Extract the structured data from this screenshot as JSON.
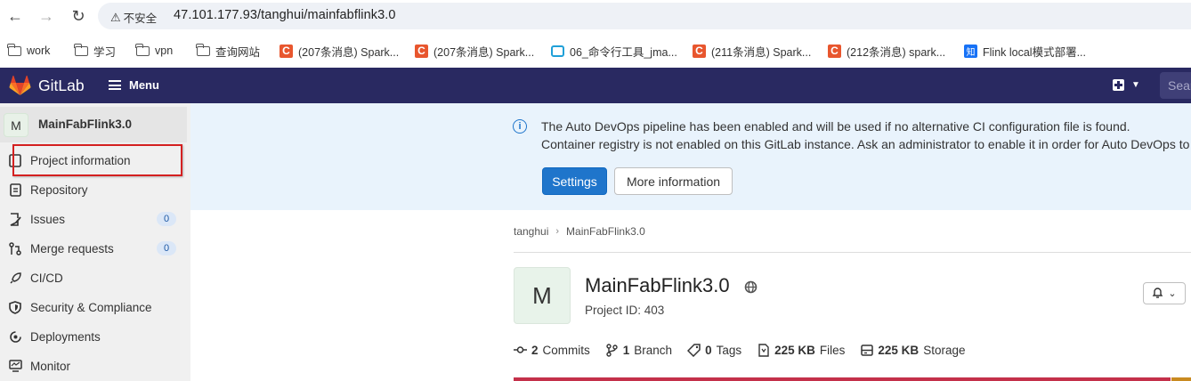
{
  "browser": {
    "insecure_label": "不安全",
    "url": "47.101.177.93/tanghui/mainfabflink3.0",
    "bookmarks": [
      {
        "label": "work",
        "icon": "folder-icon"
      },
      {
        "label": "学习",
        "icon": "folder-icon"
      },
      {
        "label": "vpn",
        "icon": "folder-icon"
      },
      {
        "label": "查询网站",
        "icon": "folder-icon"
      },
      {
        "label": "(207条消息) Spark...",
        "icon": "csdn-icon"
      },
      {
        "label": "(207条消息) Spark...",
        "icon": "csdn-icon"
      },
      {
        "label": "06_命令行工具_jma...",
        "icon": "bilibili-icon"
      },
      {
        "label": "(211条消息) Spark...",
        "icon": "csdn-icon"
      },
      {
        "label": "(212条消息) spark...",
        "icon": "csdn-icon"
      },
      {
        "label": "Flink local模式部署...",
        "icon": "zhihu-icon"
      }
    ]
  },
  "header": {
    "brand": "GitLab",
    "menu_label": "Menu",
    "search_placeholder": "Sear",
    "colors": {
      "navbar": "#292961"
    }
  },
  "sidebar": {
    "project_avatar_letter": "M",
    "project_name": "MainFabFlink3.0",
    "items": [
      {
        "label": "Project information",
        "icon": "info-document-icon"
      },
      {
        "label": "Repository",
        "icon": "document-icon"
      },
      {
        "label": "Issues",
        "icon": "issues-icon",
        "badge": "0"
      },
      {
        "label": "Merge requests",
        "icon": "merge-request-icon",
        "badge": "0"
      },
      {
        "label": "CI/CD",
        "icon": "rocket-icon"
      },
      {
        "label": "Security & Compliance",
        "icon": "shield-icon"
      },
      {
        "label": "Deployments",
        "icon": "deployments-icon"
      },
      {
        "label": "Monitor",
        "icon": "monitor-icon"
      }
    ]
  },
  "alert": {
    "line1": "The Auto DevOps pipeline has been enabled and will be used if no alternative CI configuration file is found.",
    "line2": "Container registry is not enabled on this GitLab instance. Ask an administrator to enable it in order for Auto DevOps to",
    "settings_label": "Settings",
    "more_info_label": "More information",
    "colors": {
      "background": "#e9f3fc",
      "primary": "#1f75cb"
    }
  },
  "breadcrumb": [
    "tanghui",
    "MainFabFlink3.0"
  ],
  "project": {
    "avatar_letter": "M",
    "title": "MainFabFlink3.0",
    "project_id": "Project ID: 403",
    "stats": [
      {
        "icon": "commit-icon",
        "value": "2",
        "label": "Commits"
      },
      {
        "icon": "branch-icon",
        "value": "1",
        "label": "Branch"
      },
      {
        "icon": "tag-icon",
        "value": "0",
        "label": "Tags"
      },
      {
        "icon": "file-icon",
        "value": "225 KB",
        "label": "Files"
      },
      {
        "icon": "storage-icon",
        "value": "225 KB",
        "label": "Storage"
      }
    ]
  }
}
